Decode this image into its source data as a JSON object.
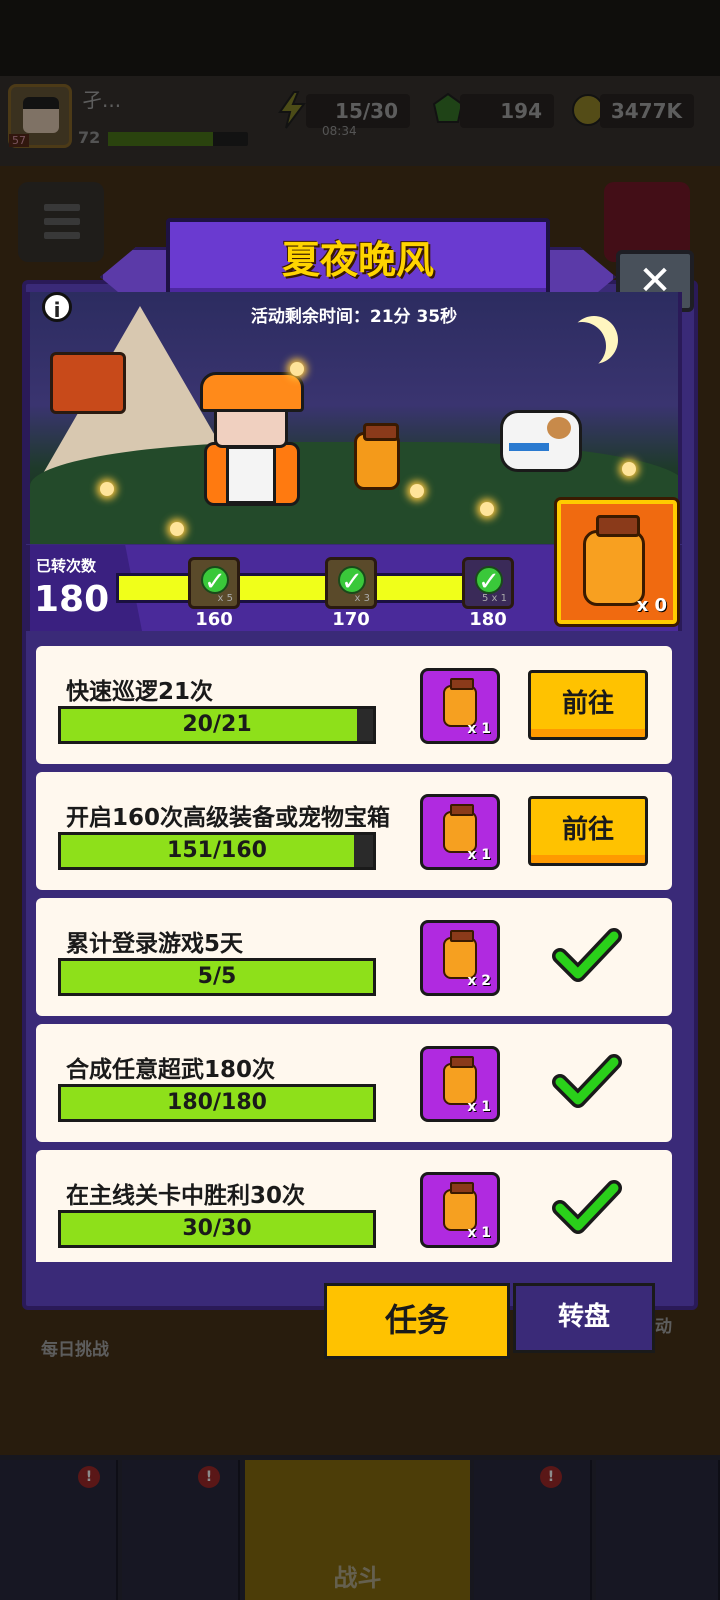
{
  "hud": {
    "player_name": "孑...",
    "player_level": "72",
    "avatar_level": "57",
    "energy": "15/30",
    "energy_timer": "08:34",
    "gems": "194",
    "gold": "3477K"
  },
  "background": {
    "daily_challenge": "每日挑战",
    "battle": "战斗",
    "right_side_label": "动"
  },
  "popup": {
    "title": "夏夜晚风",
    "close_symbol": "✕",
    "info_symbol": "i",
    "timer": "活动剩余时间：21分 35秒",
    "spin_label": "已转次数",
    "spin_count": "180",
    "spin_progress_fraction": 1.0,
    "milestones": [
      {
        "label": "160",
        "mult": "x 5"
      },
      {
        "label": "170",
        "mult": "x 3"
      },
      {
        "label": "180",
        "mult": "5 x 1"
      }
    ],
    "jar_count": "x 0"
  },
  "tasks": [
    {
      "name": "快速巡逻21次",
      "progress": "20/21",
      "fill": 0.95,
      "reward": "x 1",
      "action": "前往",
      "done": false
    },
    {
      "name": "开启160次高级装备或宠物宝箱",
      "progress": "151/160",
      "fill": 0.94,
      "reward": "x 1",
      "action": "前往",
      "done": false
    },
    {
      "name": "累计登录游戏5天",
      "progress": "5/5",
      "fill": 1.0,
      "reward": "x 2",
      "action": "",
      "done": true
    },
    {
      "name": "合成任意超武180次",
      "progress": "180/180",
      "fill": 1.0,
      "reward": "x 1",
      "action": "",
      "done": true
    },
    {
      "name": "在主线关卡中胜利30次",
      "progress": "30/30",
      "fill": 1.0,
      "reward": "x 1",
      "action": "",
      "done": true
    }
  ],
  "tabs": {
    "task": "任务",
    "wheel": "转盘"
  },
  "colors": {
    "accent_yellow": "#ffc200",
    "progress_green": "#8ee01a",
    "panel_purple": "#3a2a78",
    "reward_purple": "#b02ae0"
  }
}
